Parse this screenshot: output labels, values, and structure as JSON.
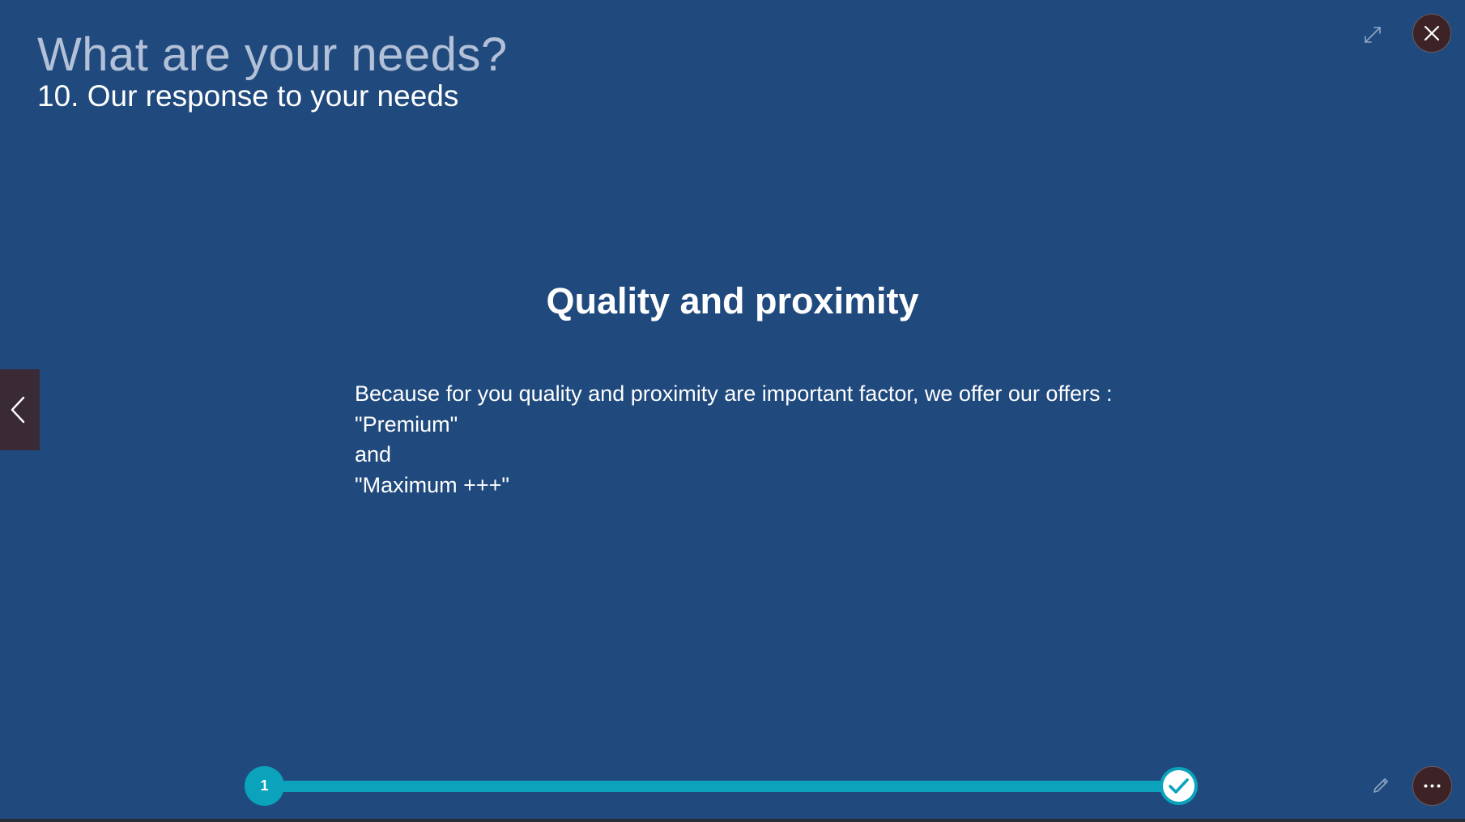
{
  "header": {
    "title": "What are your needs?",
    "subtitle": "10. Our response to your needs"
  },
  "slide": {
    "heading": "Quality and proximity",
    "body_lines": [
      "Because for you quality and proximity are important factor, we offer our offers :",
      "\"Premium\"",
      "and",
      "\"Maximum +++\""
    ]
  },
  "progress": {
    "start_step": "1",
    "current_step": 1,
    "total_steps": 1,
    "completed": true
  },
  "icons": {
    "expand": "expand-icon",
    "close": "close-icon",
    "previous": "chevron-left-icon",
    "check": "check-icon",
    "edit": "pencil-icon",
    "more": "more-horizontal-icon"
  },
  "colors": {
    "background": "#204a7d",
    "accent": "#0aa3bb",
    "title_muted": "#b3c1d8",
    "button_dark": "#3d2325",
    "text": "#ffffff"
  }
}
